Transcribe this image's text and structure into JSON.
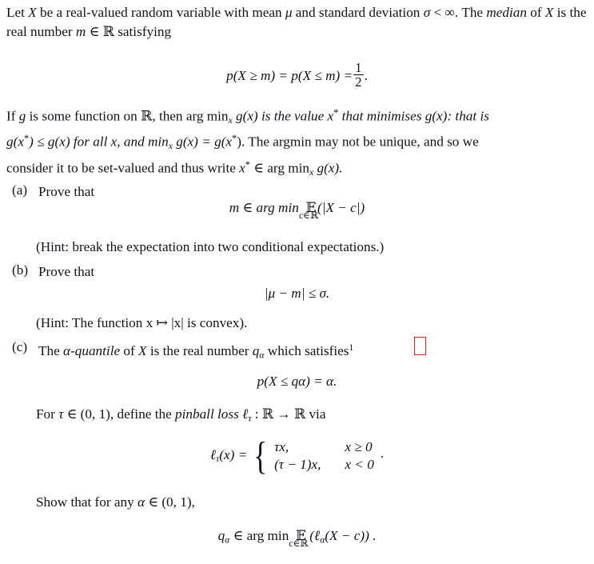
{
  "document": {
    "text_color": "#10131c",
    "background_color": "#ffffff",
    "annotation_color": "#e01b18"
  },
  "intro": {
    "line1_a": "Let ",
    "var_X": "X",
    "line1_b": " be a real-valued random variable with mean ",
    "sym_mu": "μ",
    "line1_c": " and standard deviation ",
    "sym_sigma": "σ",
    "line1_d": " < ",
    "sym_infinity": "∞",
    "line1_e": ". The",
    "line2_median": "median",
    "line2_a": " of ",
    "line2_b": " is the real number ",
    "var_m": "m",
    "sym_in": "∈",
    "sym_reals": "ℝ",
    "line2_c": " satisfying"
  },
  "eq_median": {
    "lhs": "p(X ≥ m) = p(X ≤ m) =",
    "frac_num": "1",
    "frac_den": "2",
    "trailing": "."
  },
  "argmin_para": {
    "l1_a": "If ",
    "g": "g",
    "l1_b": " is some function on ",
    "reals": "ℝ",
    "l1_c": ", then arg min",
    "sub_x": "x",
    "l1_d": " g(x) is the value ",
    "x_star": "x",
    "star": "*",
    "l1_e": " that minimises g(x): that is",
    "l2_a": "g(x",
    "l2_b": ") ≤ g(x) for all x, and min",
    "l2_c": " g(x) = g(x",
    "l2_d": "). The argmin may not be unique, and so we",
    "l3": "consider it to be set-valued and thus write ",
    "l3_b": " ∈ arg min",
    "l3_c": " g(x)."
  },
  "items": [
    {
      "label": "(a)",
      "prompt": "Prove that",
      "equation": {
        "lhs": "m ∈ arg min",
        "under": "c∈ℝ",
        "rhs": "ᴇ (|X − c|)",
        "expectation": "𝔼",
        "body": "(|X − c|)"
      },
      "hint": "(Hint: break the expectation into two conditional expectations.)"
    },
    {
      "label": "(b)",
      "prompt": "Prove that",
      "equation": {
        "text": "|μ − m| ≤ σ."
      },
      "hint": "(Hint: The function x ↦ |x| is convex)."
    },
    {
      "label": "(c)",
      "prompt_a": "The ",
      "prompt_alpha": "α-quantile",
      "prompt_b": " of ",
      "prompt_X": "X",
      "prompt_c": " is the real number ",
      "prompt_q": "q",
      "prompt_qsub": "α",
      "prompt_d": " which satisfies",
      "footnote_marker": "1",
      "equation_quantile": "p(X ≤ qα) = α.",
      "pinball_intro_a": "For ",
      "pinball_tau": "τ",
      "pinball_intro_b": " ∈ (0, 1), define the ",
      "pinball_name": "pinball loss",
      "pinball_ell": "ℓ",
      "pinball_ell_sub": "τ",
      "pinball_intro_c": " : ℝ → ℝ via",
      "pinball_lhs": "ℓ",
      "pinball_lhs_sub": "τ",
      "pinball_lhs_rest": "(x) =",
      "case_rows": [
        {
          "value": "τx,",
          "condition": "x ≥ 0"
        },
        {
          "value": "(τ − 1)x,",
          "condition": "x < 0"
        }
      ],
      "case_trailing": ".",
      "show_line_a": "Show that for any ",
      "show_alpha": "α",
      "show_line_b": " ∈ (0, 1),",
      "final_eq": {
        "lhs_q": "q",
        "lhs_sub": "α",
        "mid": " ∈ arg min",
        "under": "c∈ℝ",
        "expectation": "𝔼",
        "body": " (ℓ",
        "body_sub": "α",
        "body_rest": "(X − c)) ."
      }
    }
  ]
}
